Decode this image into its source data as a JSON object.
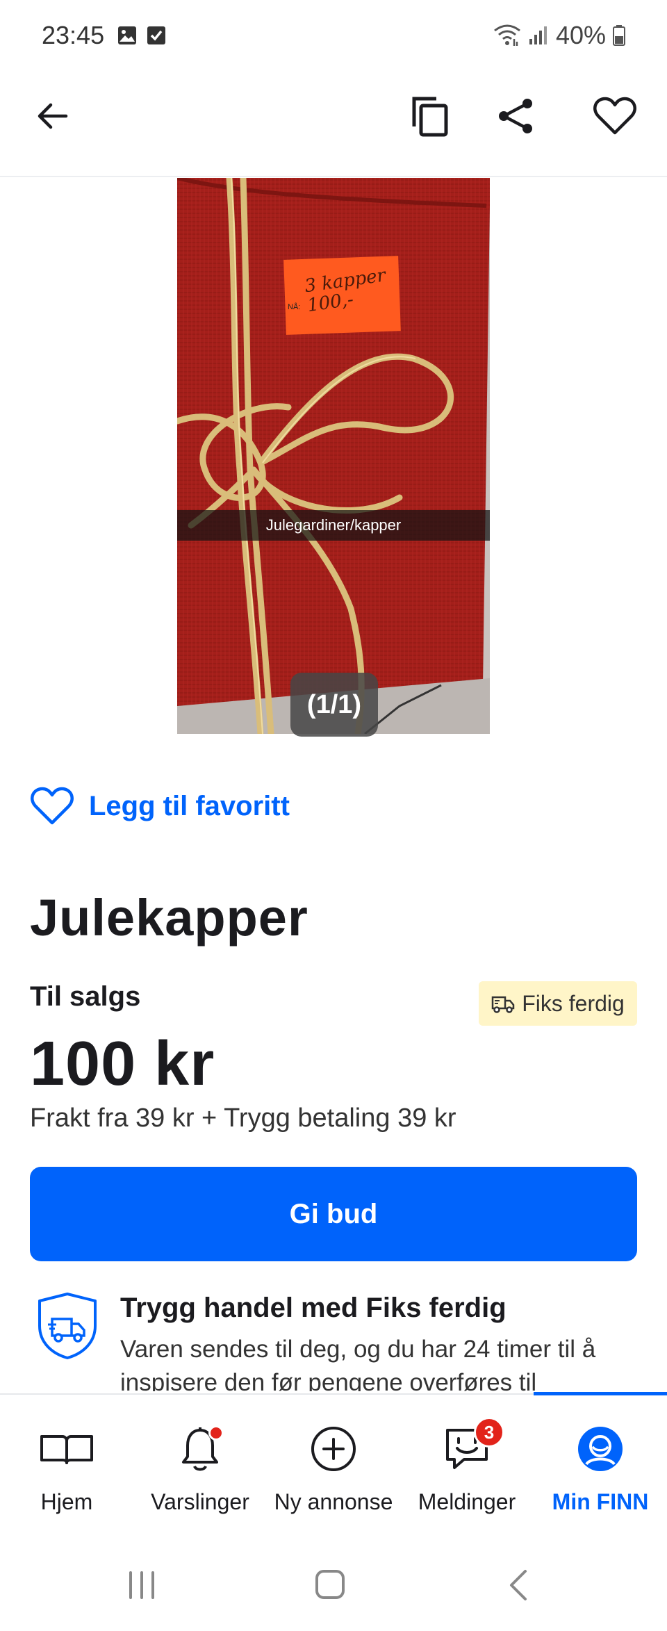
{
  "status_bar": {
    "time": "23:45",
    "battery": "40%"
  },
  "app_bar": {
    "icons": [
      "back-arrow-icon",
      "copy-icon",
      "share-icon",
      "heart-icon"
    ]
  },
  "gallery": {
    "caption": "Julegardiner/kapper",
    "counter": "(1/1)",
    "tag_text_small": "NÅ:",
    "tag_text": "3 kapper 100,-"
  },
  "favorite": {
    "label": "Legg til favoritt"
  },
  "listing": {
    "title": "Julekapper",
    "sale_label": "Til salgs",
    "badge_label": "Fiks ferdig",
    "price": "100 kr",
    "shipping": "Frakt fra 39 kr + Trygg betaling 39 kr",
    "bid_button": "Gi bud"
  },
  "safe_trade": {
    "title": "Trygg handel med Fiks ferdig",
    "text": "Varen sendes til deg, og du har 24 timer til å inspisere den før pengene overføres til"
  },
  "bottom_nav": {
    "items": [
      {
        "label": "Hjem"
      },
      {
        "label": "Varslinger"
      },
      {
        "label": "Ny annonse"
      },
      {
        "label": "Meldinger",
        "badge": "3"
      },
      {
        "label": "Min FINN"
      }
    ]
  },
  "colors": {
    "accent": "#0063fb",
    "badge_bg": "#fff5c8",
    "notification": "#e2231a"
  }
}
